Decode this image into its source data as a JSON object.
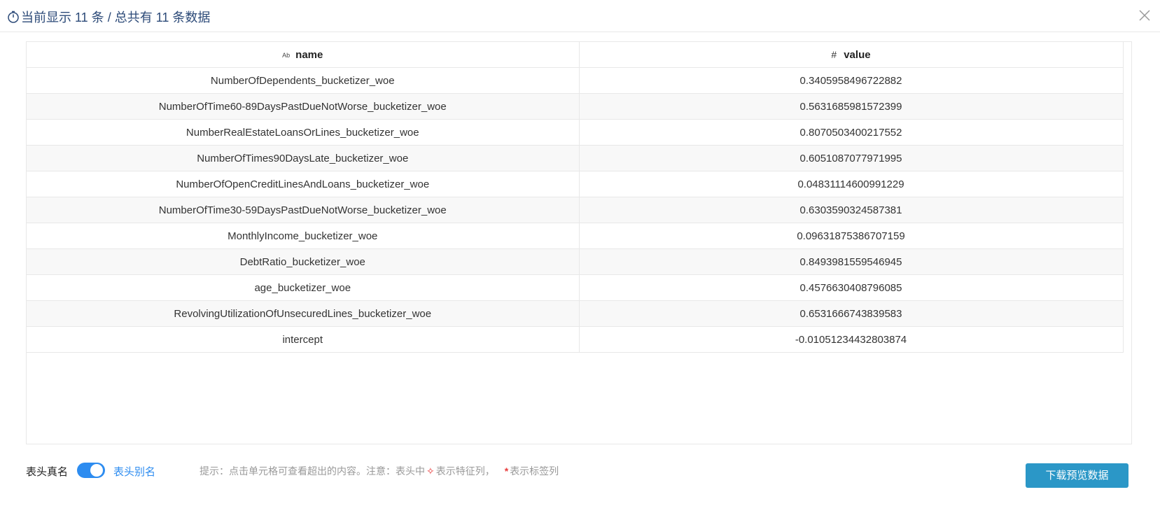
{
  "header": {
    "title": "当前显示 11 条 / 总共有 11 条数据"
  },
  "table": {
    "columns": [
      {
        "icon_text": "Ab",
        "icon": "text-type-icon",
        "label": "name"
      },
      {
        "icon_text": "#",
        "icon": "number-type-icon",
        "label": "value"
      }
    ],
    "rows": [
      {
        "name": "NumberOfDependents_bucketizer_woe",
        "value": "0.3405958496722882"
      },
      {
        "name": "NumberOfTime60-89DaysPastDueNotWorse_bucketizer_woe",
        "value": "0.5631685981572399"
      },
      {
        "name": "NumberRealEstateLoansOrLines_bucketizer_woe",
        "value": "0.8070503400217552"
      },
      {
        "name": "NumberOfTimes90DaysLate_bucketizer_woe",
        "value": "0.6051087077971995"
      },
      {
        "name": "NumberOfOpenCreditLinesAndLoans_bucketizer_woe",
        "value": "0.04831114600991229"
      },
      {
        "name": "NumberOfTime30-59DaysPastDueNotWorse_bucketizer_woe",
        "value": "0.6303590324587381"
      },
      {
        "name": "MonthlyIncome_bucketizer_woe",
        "value": "0.09631875386707159"
      },
      {
        "name": "DebtRatio_bucketizer_woe",
        "value": "0.8493981559546945"
      },
      {
        "name": "age_bucketizer_woe",
        "value": "0.4576630408796085"
      },
      {
        "name": "RevolvingUtilizationOfUnsecuredLines_bucketizer_woe",
        "value": "0.6531666743839583"
      },
      {
        "name": "intercept",
        "value": "-0.01051234432803874"
      }
    ]
  },
  "footer": {
    "real_name_label": "表头真名",
    "toggle_on": true,
    "alias_label": "表头别名",
    "hint_prefix": "提示：点击单元格可查看超出的内容。注意：表头中",
    "hint_feature": "表示特征列，",
    "hint_star": "*",
    "hint_label": "表示标签列",
    "download_label": "下载预览数据"
  },
  "colors": {
    "accent": "#2d8cf0",
    "button": "#2b97c7",
    "title": "#2c4a78",
    "marker": "#e83b3b"
  }
}
